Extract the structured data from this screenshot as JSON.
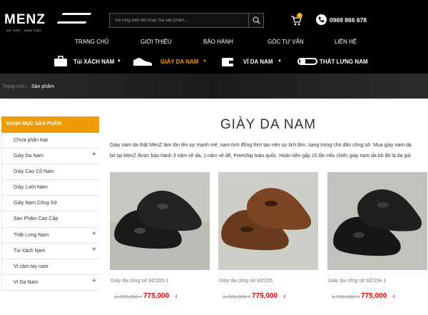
{
  "header": {
    "logo_text": "MENZ",
    "logo_tagline": "DA THẬT - NAM THẬT",
    "search_placeholder": "Vui lòng điền tên hoặc mã sản phẩm...",
    "cart_count": "0",
    "phone": "0969 866 678"
  },
  "main_nav": [
    "TRANG CHỦ",
    "GIỚI THIỆU",
    "BẢO HÀNH",
    "GÓC TƯ VẤN",
    "LIÊN HỆ"
  ],
  "category_nav": [
    {
      "label": "Túi XÁCH NAM",
      "icon": "briefcase-icon",
      "active": false
    },
    {
      "label": "GIÀY DA NAM",
      "icon": "shoe-icon",
      "active": true
    },
    {
      "label": "VÍ DA NAM",
      "icon": "wallet-icon",
      "active": false
    },
    {
      "label": "THẮT LƯNG NAM",
      "icon": "belt-icon",
      "active": false
    }
  ],
  "breadcrumb": {
    "home": "Trang chủ",
    "current": "Sản phẩm"
  },
  "sidebar": {
    "title": "DANH MỤC SẢN PHẨM",
    "items": [
      {
        "label": "Chưa phân loại",
        "expandable": false
      },
      {
        "label": "Giày Da Nam",
        "expandable": true
      },
      {
        "label": "Giày Cao Cổ Nam",
        "expandable": false
      },
      {
        "label": "Giày Lười Nam",
        "expandable": false
      },
      {
        "label": "Giày Nam Công Sở",
        "expandable": false
      },
      {
        "label": "Sản Phẩm Cao Cấp",
        "expandable": false
      },
      {
        "label": "Thắt Lưng Nam",
        "expandable": true
      },
      {
        "label": "Túi Xách Nam",
        "expandable": true
      },
      {
        "label": "Ví cầm tay nam",
        "expandable": false
      },
      {
        "label": "Ví Da Nam",
        "expandable": true
      }
    ]
  },
  "page": {
    "title": "GIÀY DA NAM",
    "intro_line1": "Giày nam da thật MenZ làm tôn lên sự mạnh mẽ, nam tính đồng thời tạo nên sự lịch lãm, sang trọng cho dân công sở. Mua giày nam da",
    "intro_line2": "bò tại MenZ được bảo hành 3 năm về da, 1 năm về đế, Freeship toàn quốc. Hoàn tiền gấp 10 lần nếu chiếc giày nam da bò đó là da giả"
  },
  "products": [
    {
      "name": "Giày da công sở MZ205-1",
      "old_price": "1,720,000 ₫",
      "price": "775,000",
      "currency": "₫",
      "color": "black"
    },
    {
      "name": "Giày da công sở MZ205",
      "old_price": "1,720,000 ₫",
      "price": "775,000",
      "currency": "₫",
      "color": "brown"
    },
    {
      "name": "Giày da công sở MZ204-1",
      "old_price": "1,720,000 ₫",
      "price": "775,000",
      "currency": "₫",
      "color": "black"
    }
  ],
  "colors": {
    "accent": "#f09c00",
    "price": "#e00000",
    "header_bg": "#000000"
  }
}
